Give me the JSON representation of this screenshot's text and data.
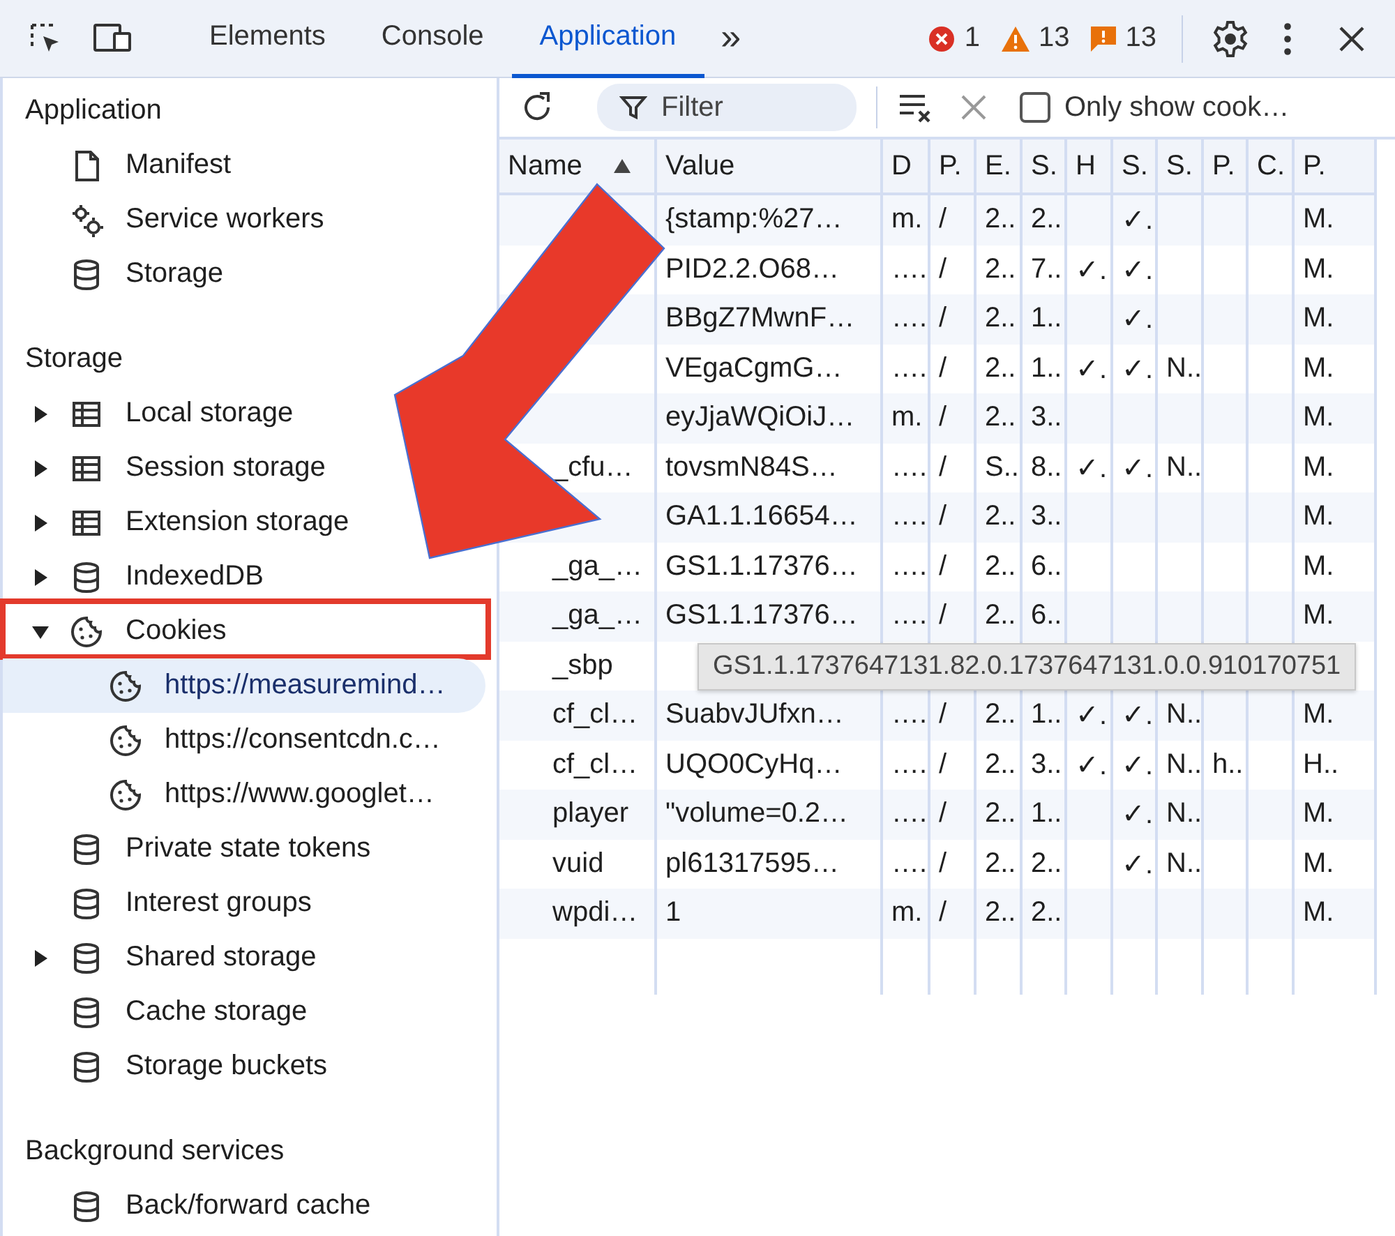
{
  "toolbar": {
    "tabs": [
      {
        "label": "Elements",
        "selected": false
      },
      {
        "label": "Console",
        "selected": false
      },
      {
        "label": "Application",
        "selected": true
      }
    ],
    "more": "»",
    "counters": [
      {
        "kind": "error",
        "count": "1"
      },
      {
        "kind": "warning",
        "count": "13"
      },
      {
        "kind": "issue",
        "count": "13"
      }
    ]
  },
  "sidebar": {
    "sections": [
      {
        "title": "Application",
        "items": [
          {
            "label": "Manifest",
            "kind": "file",
            "selected": false
          },
          {
            "label": "Service workers",
            "kind": "gears",
            "selected": false
          },
          {
            "label": "Storage",
            "kind": "database",
            "selected": false
          }
        ]
      },
      {
        "title": "Storage",
        "items": [
          {
            "label": "Local storage",
            "kind": "table",
            "expanded": false,
            "selected": false
          },
          {
            "label": "Session storage",
            "kind": "table",
            "expanded": false,
            "selected": false
          },
          {
            "label": "Extension storage",
            "kind": "table",
            "expanded": false,
            "selected": false
          },
          {
            "label": "IndexedDB",
            "kind": "database",
            "expanded": false,
            "selected": false
          },
          {
            "label": "Cookies",
            "kind": "cookie",
            "expanded": true,
            "selected": false,
            "annotated": true,
            "children": [
              {
                "label": "https://measuremind…",
                "kind": "cookie",
                "selected": true
              },
              {
                "label": "https://consentcdn.c…",
                "kind": "cookie",
                "selected": false
              },
              {
                "label": "https://www.googlet…",
                "kind": "cookie",
                "selected": false
              }
            ]
          },
          {
            "label": "Private state tokens",
            "kind": "database",
            "selected": false
          },
          {
            "label": "Interest groups",
            "kind": "database",
            "selected": false
          },
          {
            "label": "Shared storage",
            "kind": "database",
            "expanded": false,
            "selected": false
          },
          {
            "label": "Cache storage",
            "kind": "database",
            "selected": false
          },
          {
            "label": "Storage buckets",
            "kind": "database",
            "selected": false
          }
        ]
      },
      {
        "title": "Background services",
        "items": [
          {
            "label": "Back/forward cache",
            "kind": "database",
            "selected": false
          }
        ]
      }
    ]
  },
  "filter_bar": {
    "placeholder": "Filter",
    "only_show": {
      "label": "Only show cook…",
      "checked": false
    }
  },
  "table": {
    "columns": [
      {
        "label": "Name",
        "sorted": true
      },
      {
        "label": "Value",
        "sorted": false
      },
      {
        "label": "D",
        "sorted": false
      },
      {
        "label": "P.",
        "sorted": false
      },
      {
        "label": "E.",
        "sorted": false
      },
      {
        "label": "S.",
        "sorted": false
      },
      {
        "label": "H",
        "sorted": false
      },
      {
        "label": "S.",
        "sorted": false
      },
      {
        "label": "S.",
        "sorted": false
      },
      {
        "label": "P.",
        "sorted": false
      },
      {
        "label": "C.",
        "sorted": false
      },
      {
        "label": "P.",
        "sorted": false
      }
    ],
    "rows": [
      [
        null,
        "{stamp:%27…",
        "m.",
        "/",
        "2..",
        "2..",
        null,
        "✓.",
        null,
        null,
        null,
        "M."
      ],
      [
        null,
        "PID2.2.O68…",
        "….",
        "/",
        "2..",
        "7..",
        "✓.",
        "✓.",
        null,
        null,
        null,
        "M."
      ],
      [
        null,
        "BBgZ7MwnF…",
        "….",
        "/",
        "2..",
        "1...",
        null,
        "✓.",
        null,
        null,
        null,
        "M."
      ],
      [
        null,
        "VEgaCgmG…",
        "….",
        "/",
        "2..",
        "1...",
        "✓.",
        "✓.",
        "N..",
        null,
        null,
        "M."
      ],
      [
        null,
        "eyJjaWQiOiJ…",
        "m.",
        "/",
        "2..",
        "3..",
        null,
        null,
        null,
        null,
        null,
        "M."
      ],
      [
        "_cfu…",
        "tovsmN84S…",
        "….",
        "/",
        "S..",
        "8..",
        "✓.",
        "✓.",
        "N..",
        null,
        null,
        "M."
      ],
      [
        null,
        "GA1.1.16654…",
        "….",
        "/",
        "2..",
        "3..",
        null,
        null,
        null,
        null,
        null,
        "M."
      ],
      [
        "_ga_…",
        "GS1.1.17376…",
        "….",
        "/",
        "2..",
        "6..",
        null,
        null,
        null,
        null,
        null,
        "M."
      ],
      [
        "_ga_…",
        "GS1.1.17376…",
        "….",
        "/",
        "2..",
        "6..",
        null,
        null,
        null,
        null,
        null,
        "M."
      ],
      [
        "_sbp",
        null,
        null,
        null,
        null,
        null,
        null,
        null,
        null,
        null,
        null,
        null
      ],
      [
        "cf_cl…",
        "SuabvJUfxn…",
        "….",
        "/",
        "2..",
        "1...",
        "✓.",
        "✓.",
        "N..",
        null,
        null,
        "M."
      ],
      [
        "cf_cl…",
        "UQO0CyHq…",
        "….",
        "/",
        "2..",
        "3..",
        "✓.",
        "✓.",
        "N..",
        "h..",
        null,
        "H.."
      ],
      [
        "player",
        "\"volume=0.2…",
        "….",
        "/",
        "2..",
        "1...",
        null,
        "✓.",
        "N..",
        null,
        null,
        "M."
      ],
      [
        "vuid",
        "pl61317595…",
        "….",
        "/",
        "2..",
        "2..",
        null,
        "✓.",
        "N..",
        null,
        null,
        "M."
      ],
      [
        "wpdi…",
        "1",
        "m.",
        "/",
        "2..",
        "2..",
        null,
        null,
        null,
        null,
        null,
        "M."
      ]
    ],
    "tooltip": "GS1.1.1737647131.82.0.1737647131.0.0.910170751"
  },
  "annotation": {
    "kind": "arrow"
  }
}
